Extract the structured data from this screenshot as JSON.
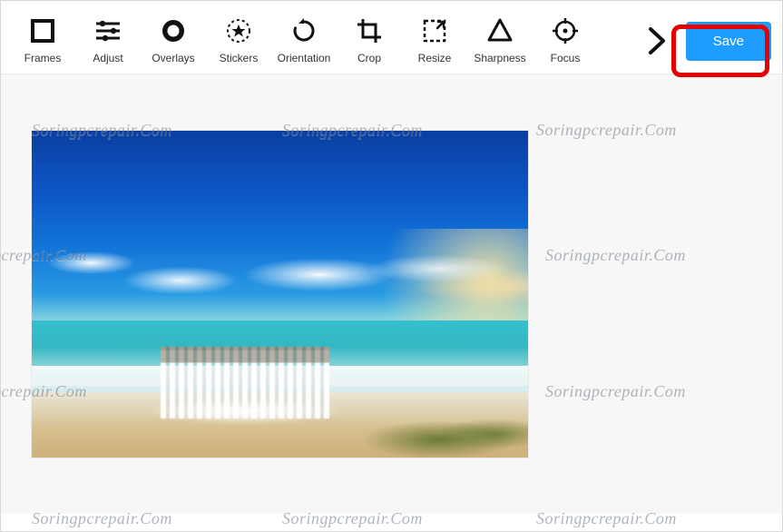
{
  "toolbar": {
    "items": [
      {
        "label": "Frames",
        "icon": "frames-icon"
      },
      {
        "label": "Adjust",
        "icon": "adjust-icon"
      },
      {
        "label": "Overlays",
        "icon": "overlays-icon"
      },
      {
        "label": "Stickers",
        "icon": "stickers-icon"
      },
      {
        "label": "Orientation",
        "icon": "orientation-icon"
      },
      {
        "label": "Crop",
        "icon": "crop-icon"
      },
      {
        "label": "Resize",
        "icon": "resize-icon"
      },
      {
        "label": "Sharpness",
        "icon": "sharpness-icon"
      },
      {
        "label": "Focus",
        "icon": "focus-icon"
      }
    ],
    "save_label": "Save"
  },
  "colors": {
    "primary": "#1e9cff",
    "highlight": "#e60000"
  },
  "watermark_text": "Soringpcrepair.Com"
}
